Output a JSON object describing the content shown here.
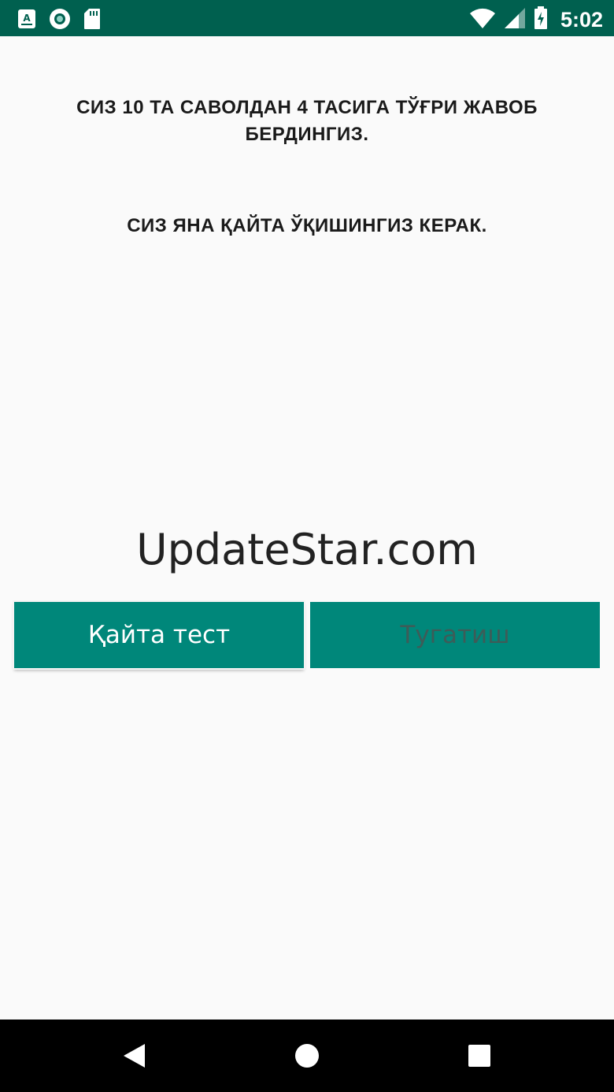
{
  "status_bar": {
    "time": "5:02",
    "left_icons": [
      "app-a-icon",
      "circle-app-icon",
      "sd-card-icon"
    ],
    "right_icons": [
      "wifi-icon",
      "cell-signal-icon",
      "battery-icon"
    ],
    "background_color": "#00604f"
  },
  "result": {
    "line1": "СИЗ 10 ТА САВОЛДАН 4 ТАСИГА ТЎҒРИ ЖАВОБ БЕРДИНГИЗ.",
    "line2": "СИЗ ЯНА ҚАЙТА ЎҚИШИНГИЗ КЕРАК."
  },
  "watermark": "UpdateStar.com",
  "buttons": {
    "retry_label": "Қайта тест",
    "finish_label": "Тугатиш",
    "accent_color": "#00877a"
  },
  "nav_bar": {
    "icons": [
      "back-icon",
      "home-icon",
      "recents-icon"
    ]
  }
}
